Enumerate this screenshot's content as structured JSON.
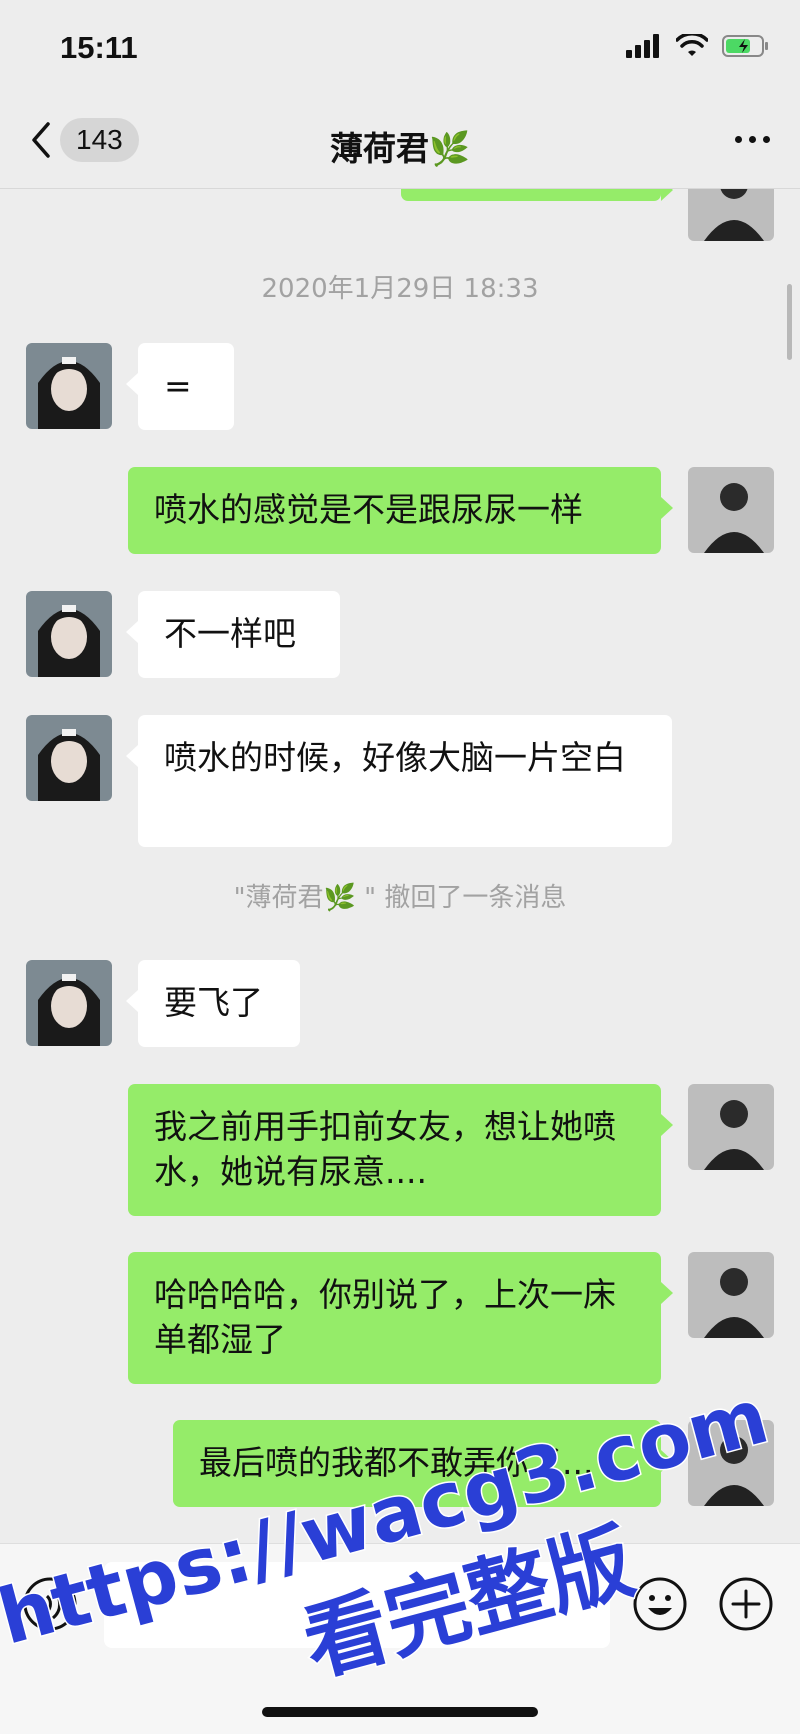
{
  "status_bar": {
    "time": "15:11"
  },
  "nav": {
    "unread_count": "143",
    "title": "薄荷君🌿"
  },
  "chat": {
    "timestamp": "2020年1月29日 18:33",
    "messages": [
      {
        "side": "in",
        "text": "="
      },
      {
        "side": "out",
        "text": "喷水的感觉是不是跟尿尿一样"
      },
      {
        "side": "in",
        "text": "不一样吧"
      },
      {
        "side": "in",
        "text": "喷水的时候，好像大脑一片空白"
      },
      {
        "side": "in",
        "text": "要飞了"
      },
      {
        "side": "out",
        "text": "我之前用手扣前女友，想让她喷水，她说有尿意...."
      },
      {
        "side": "out",
        "text": "哈哈哈哈，你别说了，上次一床单都湿了"
      },
      {
        "side": "out",
        "text": "最后喷的我都不敢弄你了..."
      }
    ],
    "recall_notice": "\"薄荷君🌿 \" 撤回了一条消息"
  },
  "watermark": {
    "url": "https://wacg3.com",
    "caption": "看完整版"
  },
  "colors": {
    "outgoing_bubble": "#95ec69",
    "incoming_bubble": "#ffffff",
    "background": "#ededed",
    "watermark": "#2a3fd6"
  },
  "icons": [
    "back-chevron-icon",
    "more-icon",
    "voice-icon",
    "emoji-icon",
    "plus-icon",
    "signal-icon",
    "wifi-icon",
    "battery-icon"
  ]
}
